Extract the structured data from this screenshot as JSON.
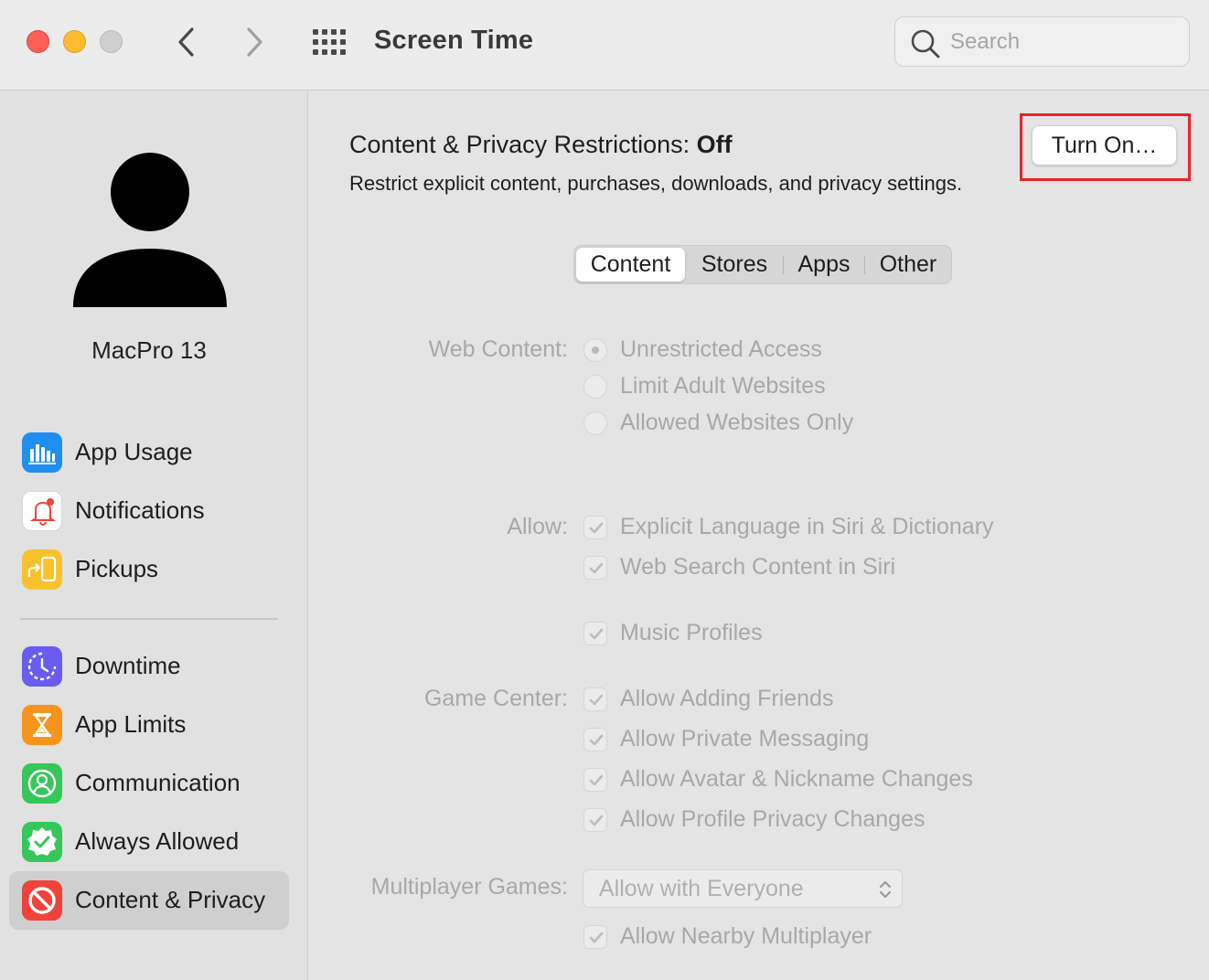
{
  "window": {
    "title": "Screen Time",
    "search_placeholder": "Search"
  },
  "sidebar": {
    "user_name": "MacPro 13",
    "items": [
      {
        "label": "App Usage",
        "icon": "bar-chart-icon",
        "color": "#1f8ef0"
      },
      {
        "label": "Notifications",
        "icon": "bell-icon",
        "color": "#ffffff"
      },
      {
        "label": "Pickups",
        "icon": "pickup-phone-icon",
        "color": "#f9c22c"
      },
      {
        "label": "Downtime",
        "icon": "moon-clock-icon",
        "color": "#6a5cf1"
      },
      {
        "label": "App Limits",
        "icon": "hourglass-icon",
        "color": "#f7941d"
      },
      {
        "label": "Communication",
        "icon": "person-circle-icon",
        "color": "#35c759"
      },
      {
        "label": "Always Allowed",
        "icon": "check-badge-icon",
        "color": "#35c759"
      },
      {
        "label": "Content & Privacy",
        "icon": "prohibited-icon",
        "color": "#f0433a",
        "selected": true
      }
    ]
  },
  "main": {
    "status_prefix": "Content & Privacy Restrictions:",
    "status_value": "Off",
    "description": "Restrict explicit content, purchases, downloads, and privacy settings.",
    "turn_on_label": "Turn On…",
    "tabs": [
      "Content",
      "Stores",
      "Apps",
      "Other"
    ],
    "active_tab": "Content",
    "web_content": {
      "label": "Web Content:",
      "options": [
        "Unrestricted Access",
        "Limit Adult Websites",
        "Allowed Websites Only"
      ],
      "selected": "Unrestricted Access"
    },
    "allow": {
      "label": "Allow:",
      "options": [
        "Explicit Language in Siri & Dictionary",
        "Web Search Content in Siri",
        "Music Profiles"
      ]
    },
    "game_center": {
      "label": "Game Center:",
      "options": [
        "Allow Adding Friends",
        "Allow Private Messaging",
        "Allow Avatar & Nickname Changes",
        "Allow Profile Privacy Changes"
      ]
    },
    "multiplayer": {
      "label": "Multiplayer Games:",
      "value": "Allow with Everyone",
      "nearby_label": "Allow Nearby Multiplayer"
    }
  },
  "colors": {
    "highlight_frame": "#e3262a"
  }
}
